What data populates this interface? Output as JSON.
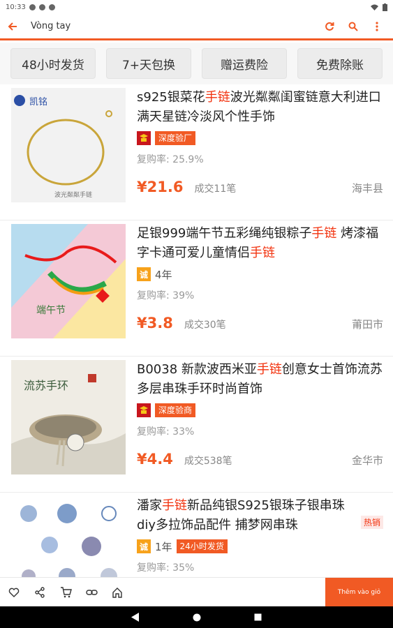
{
  "status_bar": {
    "time": "10:33"
  },
  "app_bar": {
    "title": "Vòng tay"
  },
  "filters": [
    "48小时发货",
    "7+天包换",
    "赠运费险",
    "免费除账"
  ],
  "products": [
    {
      "title_parts": [
        {
          "text": "s925银菜花",
          "hl": false
        },
        {
          "text": "手链",
          "hl": true
        },
        {
          "text": "波光粼粼闺蜜链意大利进口满天星链冷淡风个性手饰",
          "hl": false
        }
      ],
      "badge_type": "factory",
      "tag": "深度验厂",
      "years": "",
      "tag2": "",
      "hot": "",
      "repurchase": "复购率: 25.9%",
      "price": "¥21.6",
      "deals": "成交11笔",
      "location": "海丰县",
      "thumb_logo": "凯铭",
      "thumb_caption": "波光粼粼手链"
    },
    {
      "title_parts": [
        {
          "text": "足银999端午节五彩绳纯银粽子",
          "hl": false
        },
        {
          "text": "手链",
          "hl": true
        },
        {
          "text": " 烤漆福字卡通可爱儿童情侣",
          "hl": false
        },
        {
          "text": "手链",
          "hl": true
        }
      ],
      "badge_type": "cheng",
      "tag": "",
      "years": "4年",
      "tag2": "",
      "hot": "",
      "repurchase": "复购率: 39%",
      "price": "¥3.8",
      "deals": "成交30笔",
      "location": "莆田市",
      "thumb_logo": "端午节",
      "thumb_caption": ""
    },
    {
      "title_parts": [
        {
          "text": "B0038 新款波西米亚",
          "hl": false
        },
        {
          "text": "手链",
          "hl": true
        },
        {
          "text": "创意女士首饰流苏多层串珠手环时尚首饰",
          "hl": false
        }
      ],
      "badge_type": "factory",
      "tag": "深度验商",
      "years": "",
      "tag2": "",
      "hot": "",
      "repurchase": "复购率: 33%",
      "price": "¥4.4",
      "deals": "成交538笔",
      "location": "金华市",
      "thumb_logo": "流苏手环",
      "thumb_caption": ""
    },
    {
      "title_parts": [
        {
          "text": "潘家",
          "hl": false
        },
        {
          "text": "手链",
          "hl": true
        },
        {
          "text": "新品纯银S925银珠子银串珠 diy多拉饰品配件 捕梦网串珠",
          "hl": false
        }
      ],
      "badge_type": "cheng",
      "tag": "",
      "years": "1年",
      "tag2": "24小时发货",
      "hot": "热销",
      "repurchase": "复购率: 35%",
      "price": "",
      "deals": "",
      "location": "",
      "thumb_logo": "",
      "thumb_caption": ""
    }
  ],
  "badges": {
    "cheng_label": "诚"
  },
  "action_bar": {
    "add_label": "Thêm vào giỏ"
  },
  "colors": {
    "accent": "#f15a24",
    "highlight": "#f2320e"
  }
}
